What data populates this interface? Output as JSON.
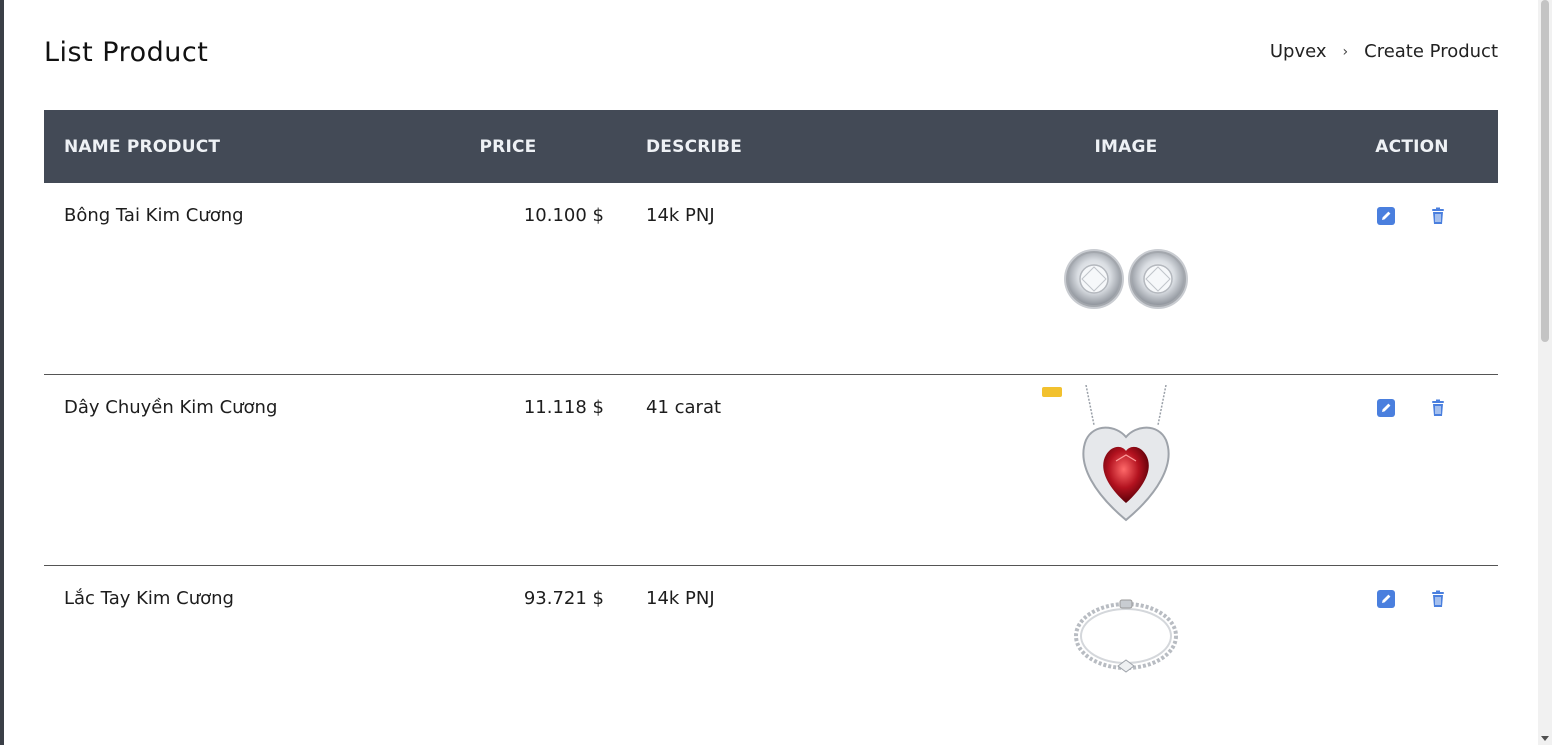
{
  "page": {
    "title": "List Product"
  },
  "breadcrumb": {
    "items": [
      "Upvex",
      "Create Product"
    ],
    "separator": "›"
  },
  "table": {
    "columns": [
      "NAME PRODUCT",
      "PRICE",
      "DESCRIBE",
      "IMAGE",
      "ACTION"
    ],
    "rows": [
      {
        "name": "Bông Tai Kim Cương",
        "price": "10.100 $",
        "describe": "14k PNJ",
        "image": "diamond-earrings-image"
      },
      {
        "name": "Dây Chuyền Kim Cương",
        "price": "11.118 $",
        "describe": "41 carat",
        "image": "ruby-necklace-image"
      },
      {
        "name": "Lắc Tay Kim Cương",
        "price": "93.721 $",
        "describe": "14k PNJ",
        "image": "diamond-bracelet-image"
      }
    ]
  },
  "icons": {
    "edit": "pencil-square-icon",
    "delete": "trash-icon"
  },
  "colors": {
    "header_bg": "#434a56",
    "header_text": "#eef1f5",
    "action_icon": "#4a7fde",
    "ruby": "#b3121f"
  }
}
